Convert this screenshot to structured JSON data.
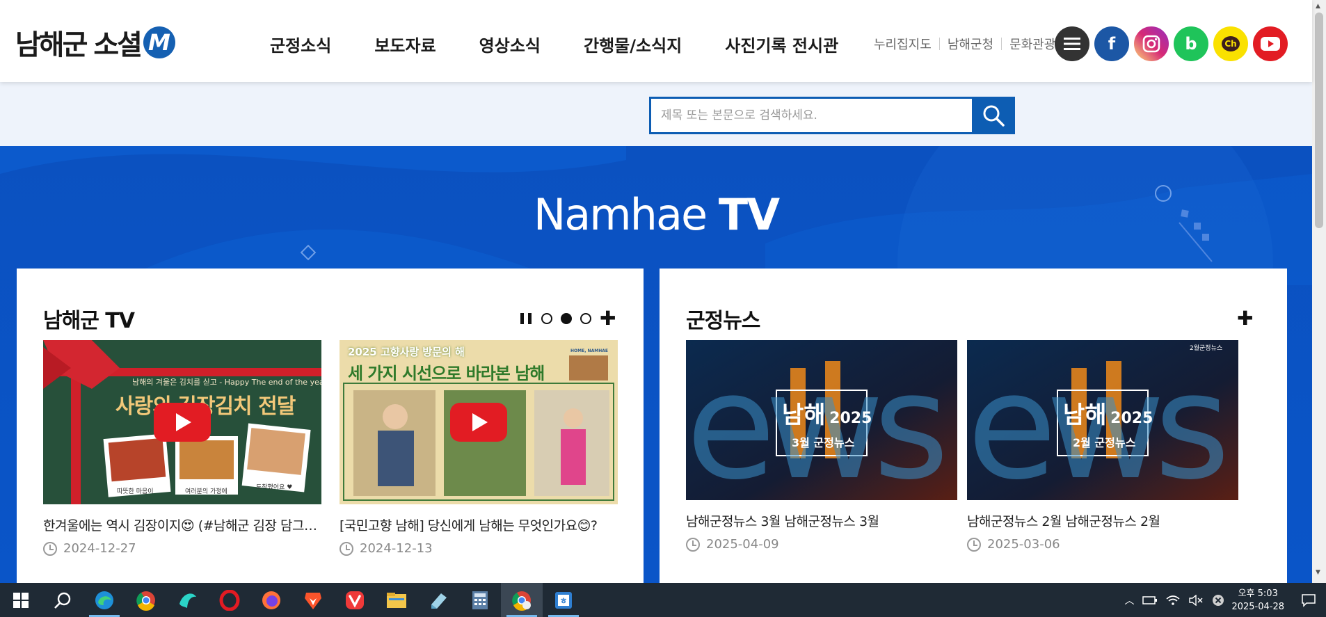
{
  "header": {
    "logo_text": "남해군 소셜",
    "logo_mark": "M",
    "nav": [
      "군정소식",
      "보도자료",
      "영상소식",
      "간행물/소식지",
      "사진기록 전시관"
    ],
    "utility_links": [
      "누리집지도",
      "남해군청",
      "문화관광"
    ],
    "socials": [
      {
        "name": "menu-icon",
        "color": "#333333"
      },
      {
        "name": "facebook-icon",
        "label": "f",
        "color": "#1c57a5"
      },
      {
        "name": "instagram-icon",
        "color": "#d62976"
      },
      {
        "name": "band-icon",
        "label": "b",
        "color": "#1fc45a"
      },
      {
        "name": "kakao-channel-icon",
        "label": "Ch",
        "color": "#fae100"
      },
      {
        "name": "youtube-icon",
        "color": "#e21c23"
      }
    ]
  },
  "search": {
    "placeholder": "제목 또는 본문으로 검색하세요."
  },
  "hero": {
    "title_light": "Namhae ",
    "title_bold": "TV"
  },
  "left_card": {
    "title": "남해군 TV",
    "items": [
      {
        "thumb_text_top": "남해의 겨울은 김치를 싣고 - Happy The end of the year",
        "thumb_text_main": "사랑의 김장김치 전달",
        "thumb_labels": [
          "따뜻한 마음이",
          "여러분의 가정에",
          "도착했어요 ♥"
        ],
        "caption": "한겨울에는 역시 김장이지😍 (#남해군 김장 담그기 ...",
        "date": "2024-12-27"
      },
      {
        "thumb_text_top": "2025 고향사랑 방문의 해",
        "thumb_text_main": "세 가지 시선으로 바라본 남해",
        "thumb_badge": "HOME, NAMHAE",
        "caption": "[국민고향 남해] 당신에게 남해는 무엇인가요😊?",
        "date": "2024-12-13"
      }
    ]
  },
  "right_card": {
    "title": "군정뉴스",
    "items": [
      {
        "thumb_word": "ews",
        "thumb_title": "남해",
        "thumb_year": "2025",
        "thumb_sub": "3월 군정뉴스",
        "caption": "남해군정뉴스 3월 남해군정뉴스 3월",
        "date": "2025-04-09"
      },
      {
        "thumb_word": "ews",
        "thumb_corner": "2월군정뉴스",
        "thumb_title": "남해",
        "thumb_year": "2025",
        "thumb_sub": "2월 군정뉴스",
        "caption": "남해군정뉴스 2월 남해군정뉴스 2월",
        "date": "2025-03-06"
      }
    ]
  },
  "taskbar": {
    "apps": [
      "windows-start-icon",
      "search-icon",
      "edge-icon",
      "chrome-icon",
      "app-bird-icon",
      "opera-icon",
      "firefox-icon",
      "brave-icon",
      "vivaldi-icon",
      "file-explorer-icon",
      "notepad-icon",
      "calculator-icon",
      "chrome-active-icon",
      "hangul-icon"
    ],
    "time": "오후 5:03",
    "date": "2025-04-28"
  }
}
